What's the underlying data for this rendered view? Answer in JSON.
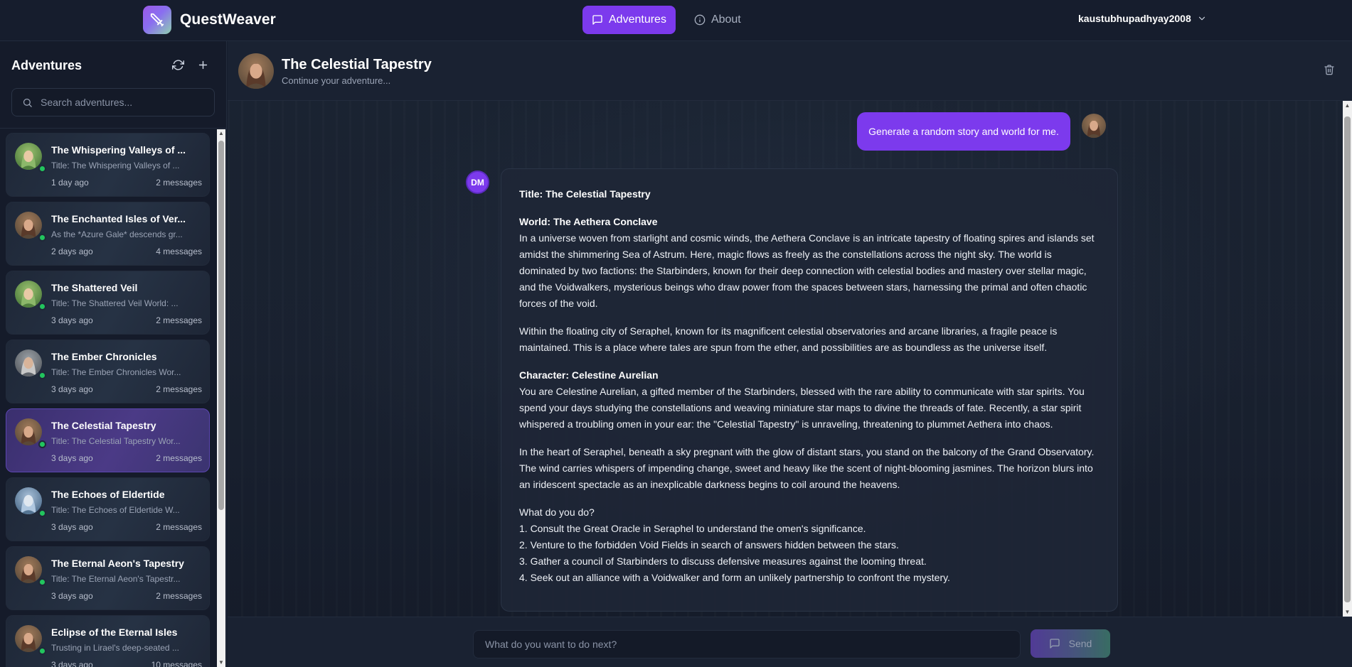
{
  "app": {
    "name": "QuestWeaver",
    "logo_icon": "sword-icon"
  },
  "nav": {
    "adventures_label": "Adventures",
    "about_label": "About",
    "username": "kaustubhupadhyay2008"
  },
  "sidebar": {
    "title": "Adventures",
    "search_placeholder": "Search adventures...",
    "items": [
      {
        "title": "The Whispering Valleys of ...",
        "subtitle": "Title: The Whispering Valleys of ...",
        "time": "1 day ago",
        "count": "2 messages",
        "avatar": "elf-green"
      },
      {
        "title": "The Enchanted Isles of Ver...",
        "subtitle": "As the *Azure Gale* descends gr...",
        "time": "2 days ago",
        "count": "4 messages",
        "avatar": "woman-brown"
      },
      {
        "title": "The Shattered Veil",
        "subtitle": "Title: The Shattered Veil World: ...",
        "time": "3 days ago",
        "count": "2 messages",
        "avatar": "elf-green"
      },
      {
        "title": "The Ember Chronicles",
        "subtitle": "Title: The Ember Chronicles Wor...",
        "time": "3 days ago",
        "count": "2 messages",
        "avatar": "wizard-grey"
      },
      {
        "title": "The Celestial Tapestry",
        "subtitle": "Title: The Celestial Tapestry Wor...",
        "time": "3 days ago",
        "count": "2 messages",
        "avatar": "woman-brown",
        "active": true
      },
      {
        "title": "The Echoes of Eldertide",
        "subtitle": "Title: The Echoes of Eldertide W...",
        "time": "3 days ago",
        "count": "2 messages",
        "avatar": "ghost-blue"
      },
      {
        "title": "The Eternal Aeon's Tapestry",
        "subtitle": "Title: The Eternal Aeon's Tapestr...",
        "time": "3 days ago",
        "count": "2 messages",
        "avatar": "woman-brown"
      },
      {
        "title": "Eclipse of the Eternal Isles",
        "subtitle": "Trusting in Lirael's deep-seated ...",
        "time": "3 days ago",
        "count": "10 messages",
        "avatar": "woman-brown"
      }
    ]
  },
  "chat": {
    "title": "The Celestial Tapestry",
    "subtitle": "Continue your adventure...",
    "user_message": "Generate a random story and world for me.",
    "dm_label": "DM",
    "response": {
      "title_line": "Title: The Celestial Tapestry",
      "world_heading": "World: The Aethera Conclave",
      "world_text": "In a universe woven from starlight and cosmic winds, the Aethera Conclave is an intricate tapestry of floating spires and islands set amidst the shimmering Sea of Astrum. Here, magic flows as freely as the constellations across the night sky. The world is dominated by two factions: the Starbinders, known for their deep connection with celestial bodies and mastery over stellar magic, and the Voidwalkers, mysterious beings who draw power from the spaces between stars, harnessing the primal and often chaotic forces of the void.",
      "city_text": "Within the floating city of Seraphel, known for its magnificent celestial observatories and arcane libraries, a fragile peace is maintained. This is a place where tales are spun from the ether, and possibilities are as boundless as the universe itself.",
      "character_heading": "Character: Celestine Aurelian",
      "character_text": "You are Celestine Aurelian, a gifted member of the Starbinders, blessed with the rare ability to communicate with star spirits. You spend your days studying the constellations and weaving miniature star maps to divine the threads of fate. Recently, a star spirit whispered a troubling omen in your ear: the \"Celestial Tapestry\" is unraveling, threatening to plummet Aethera into chaos.",
      "scene_text": "In the heart of Seraphel, beneath a sky pregnant with the glow of distant stars, you stand on the balcony of the Grand Observatory. The wind carries whispers of impending change, sweet and heavy like the scent of night-blooming jasmines. The horizon blurs into an iridescent spectacle as an inexplicable darkness begins to coil around the heavens.",
      "question": "What do you do?",
      "options": [
        "1. Consult the Great Oracle in Seraphel to understand the omen's significance.",
        "2. Venture to the forbidden Void Fields in search of answers hidden between the stars.",
        "3. Gather a council of Starbinders to discuss defensive measures against the looming threat.",
        "4. Seek out an alliance with a Voidwalker and form an unlikely partnership to confront the mystery."
      ]
    }
  },
  "composer": {
    "placeholder": "What do you want to do next?",
    "send_label": "Send"
  },
  "colors": {
    "accent": "#7c3aed",
    "online": "#22c55e",
    "background": "#151c2c"
  }
}
